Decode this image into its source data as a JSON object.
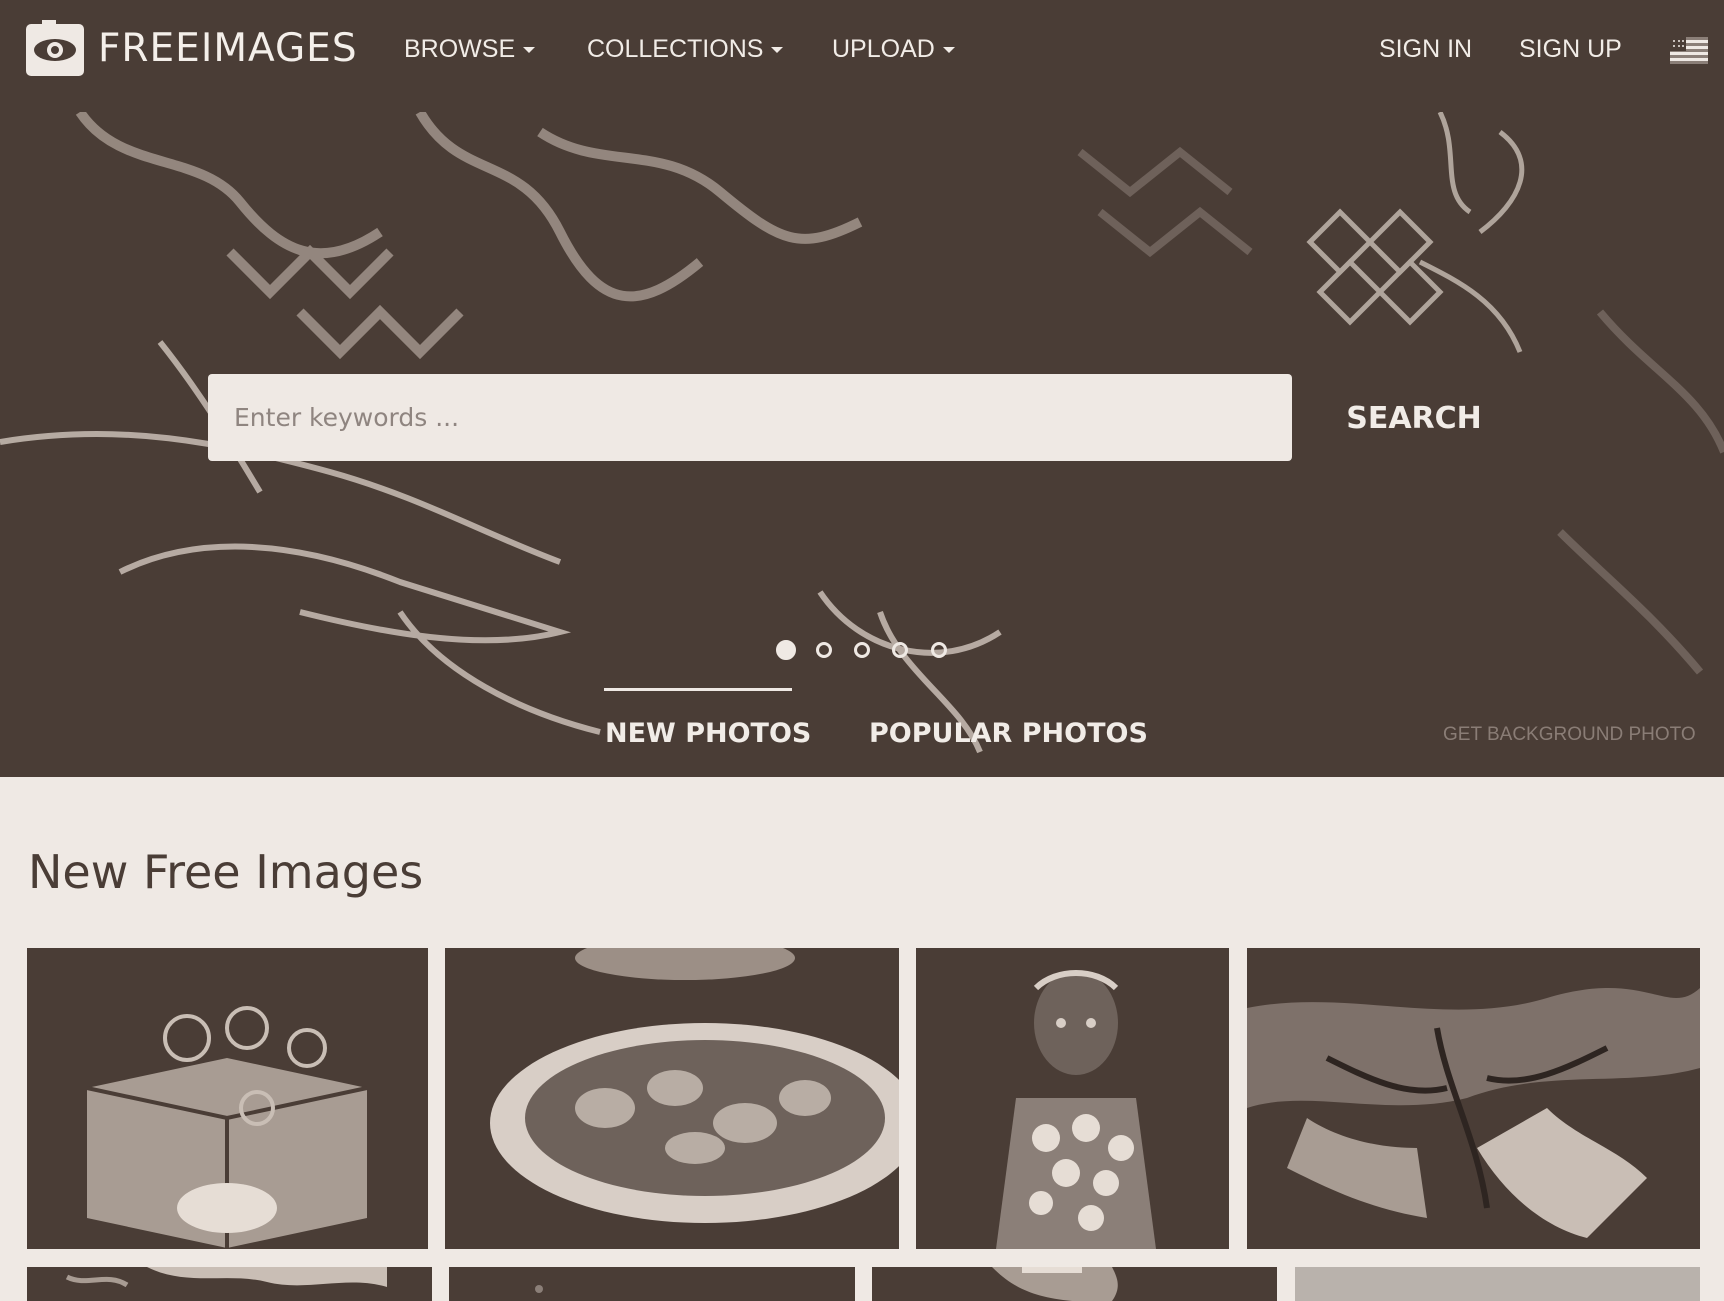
{
  "brand": {
    "name": "FREEIMAGES"
  },
  "nav": {
    "browse": "BROWSE",
    "collections": "COLLECTIONS",
    "upload": "UPLOAD",
    "sign_in": "SIGN IN",
    "sign_up": "SIGN UP",
    "language_icon": "us-flag-icon"
  },
  "hero": {
    "search_placeholder": "Enter keywords ...",
    "search_button": "SEARCH",
    "slide_count": 5,
    "active_slide": 1,
    "tabs": {
      "new": "NEW PHOTOS",
      "popular": "POPULAR PHOTOS"
    },
    "active_tab": "new",
    "background_link": "GET BACKGROUND PHOTO"
  },
  "gallery": {
    "title": "New Free Images",
    "thumbnails": [
      "square-gift-box",
      "food-plate",
      "girl-with-flowers",
      "tree-branches",
      "foliage",
      "dark-photo",
      "person-closeup",
      "gray-photo"
    ]
  },
  "colors": {
    "dark": "#4a3d36",
    "light": "#efe9e4"
  }
}
